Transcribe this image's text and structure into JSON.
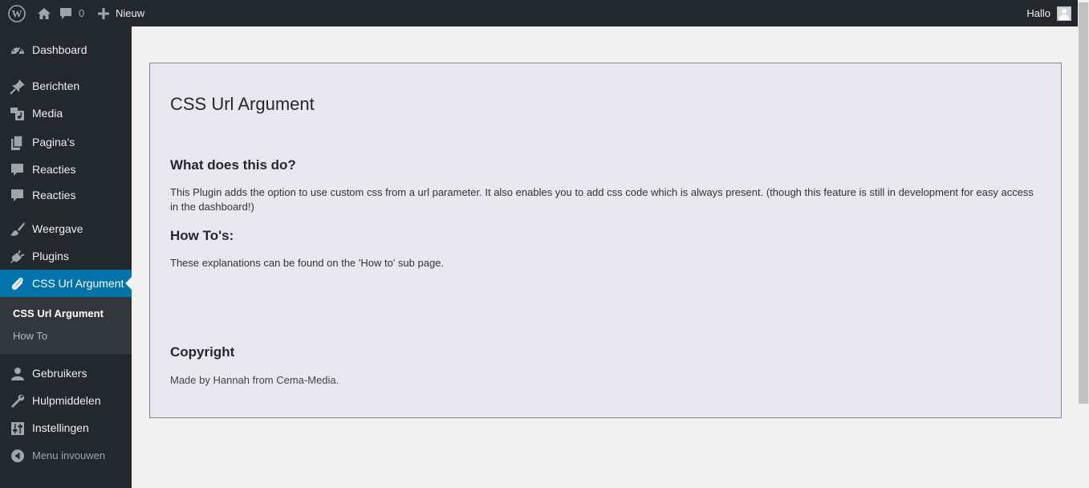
{
  "adminbar": {
    "wp_logo": "wordpress-logo-icon",
    "home_icon": "home-icon",
    "comments_icon": "comment-icon",
    "comments_count": "0",
    "new_icon": "plus-icon",
    "new_label": "Nieuw",
    "hello_label": "Hallo",
    "avatar_icon": "avatar-icon"
  },
  "sidebar": {
    "items": [
      {
        "label": "Dashboard",
        "icon": "dashboard-icon"
      },
      {
        "label": "Berichten",
        "icon": "pin-icon"
      },
      {
        "label": "Media",
        "icon": "media-icon"
      },
      {
        "label": "Pagina's",
        "icon": "pages-icon"
      },
      {
        "label": "Reacties",
        "icon": "comment-icon"
      },
      {
        "label": "Reacties",
        "icon": "comment-icon"
      },
      {
        "label": "Weergave",
        "icon": "brush-icon"
      },
      {
        "label": "Plugins",
        "icon": "plugin-icon"
      },
      {
        "label": "CSS Url Argument",
        "icon": "paperclip-icon"
      },
      {
        "label": "Gebruikers",
        "icon": "user-icon"
      },
      {
        "label": "Hulpmiddelen",
        "icon": "wrench-icon"
      },
      {
        "label": "Instellingen",
        "icon": "settings-icon"
      },
      {
        "label": "Menu invouwen",
        "icon": "collapse-icon"
      }
    ],
    "submenu": [
      {
        "label": "CSS Url Argument"
      },
      {
        "label": "How To"
      }
    ]
  },
  "colors": {
    "adminbar_bg": "#23282d",
    "active_bg": "#0073aa",
    "content_bg": "#e9e8ee"
  },
  "content": {
    "title": "CSS Url Argument",
    "section1_heading": "What does this do?",
    "section1_text": "This Plugin adds the option to use custom css from a url parameter. It also enables you to add css code which is always present. (though this feature is still in development for easy access in the dashboard!)",
    "section2_heading": "How To's:",
    "section2_text": "These explanations can be found on the 'How to' sub page.",
    "section3_heading": "Copyright",
    "section3_text": "Made by Hannah from Cema-Media."
  }
}
